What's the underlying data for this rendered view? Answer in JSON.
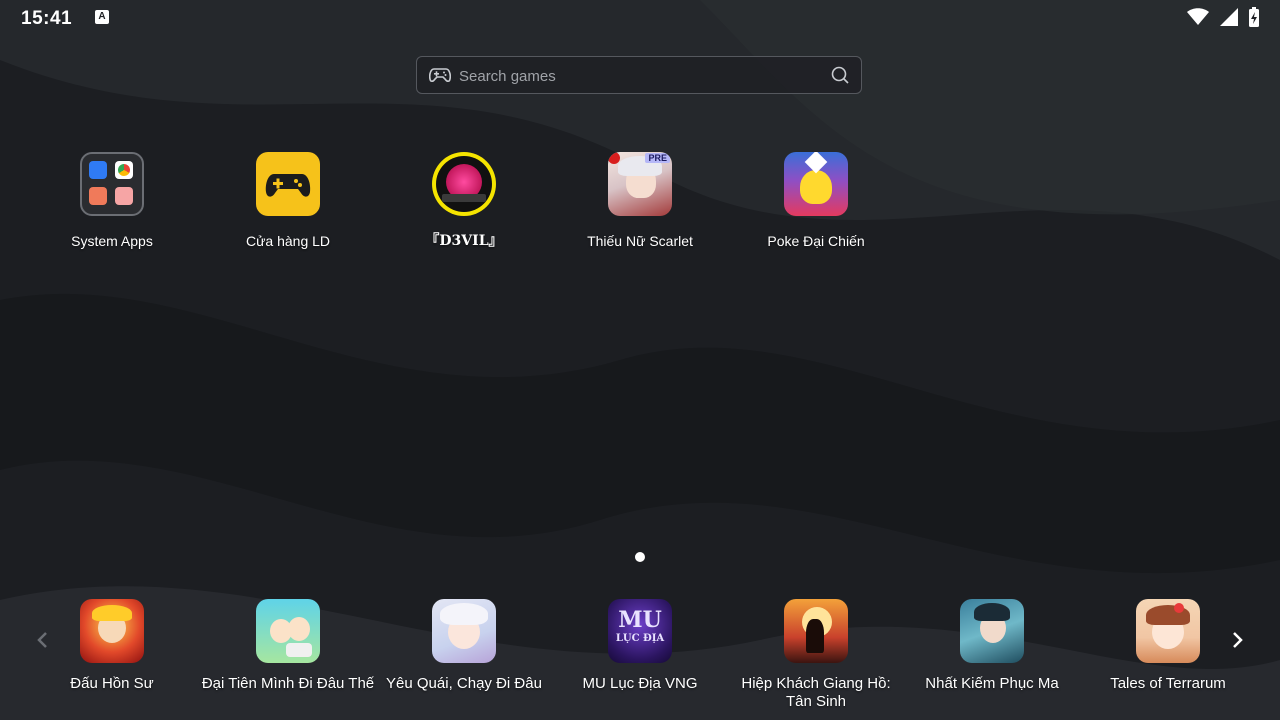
{
  "status_bar": {
    "time": "15:41",
    "keyboard_badge": "A"
  },
  "search": {
    "placeholder": "Search games"
  },
  "home_apps": [
    {
      "label": "System Apps"
    },
    {
      "label": "Cửa hàng LD"
    },
    {
      "label": "『D3VIL』"
    },
    {
      "label": "Thiếu Nữ Scarlet",
      "badge": "PRE"
    },
    {
      "label": "Poke Đại Chiến"
    }
  ],
  "dock_apps": [
    {
      "label": "Đấu Hồn Sư"
    },
    {
      "label": "Đại Tiên Mình Đi Đâu Thế"
    },
    {
      "label": "Yêu Quái, Chạy Đi Đâu"
    },
    {
      "label": "MU Lục Địa VNG",
      "icon_text": "MU",
      "icon_subtext": "LỤC ĐỊA"
    },
    {
      "label": "Hiệp Khách Giang Hồ: Tân Sinh"
    },
    {
      "label": "Nhất Kiếm Phục Ma"
    },
    {
      "label": "Tales of Terrarum"
    }
  ],
  "colors": {
    "background": "#1e2024",
    "store_icon": "#f6c21a",
    "devil_ring": "#f5e400",
    "devil_inner": "#c2175b"
  }
}
